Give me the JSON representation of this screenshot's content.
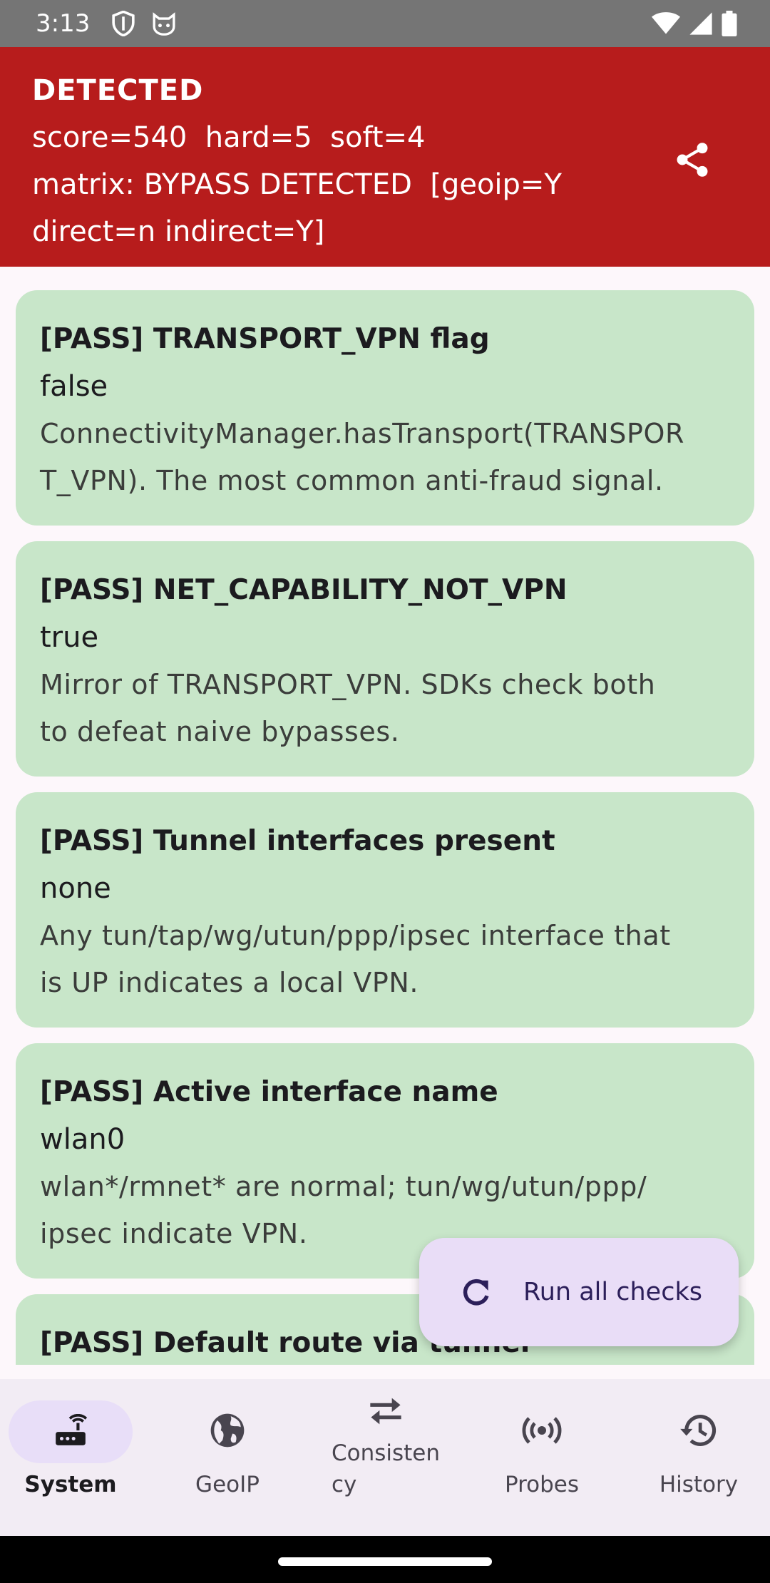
{
  "status_bar": {
    "time": "3:13",
    "icons": [
      "shield-icon",
      "cat-face-icon",
      "wifi-icon",
      "signal-icon",
      "battery-icon"
    ]
  },
  "banner": {
    "title": "DETECTED",
    "score_line": "score=540  hard=5  soft=4",
    "matrix_line1": "matrix: BYPASS DETECTED  [geoip=Y",
    "matrix_line2": "direct=n indirect=Y]",
    "color": "#b71c1c",
    "share_icon": "share-icon"
  },
  "cards": [
    {
      "title": "[PASS] TRANSPORT_VPN flag",
      "value": "false",
      "desc_line1": "ConnectivityManager.hasTransport(TRANSPOR",
      "desc_line2": "T_VPN). The most common anti-fraud signal."
    },
    {
      "title": "[PASS] NET_CAPABILITY_NOT_VPN",
      "value": "true",
      "desc_line1": "Mirror of TRANSPORT_VPN. SDKs check both",
      "desc_line2": "to defeat naive bypasses."
    },
    {
      "title": "[PASS] Tunnel interfaces present",
      "value": "none",
      "desc_line1": "Any tun/tap/wg/utun/ppp/ipsec interface that",
      "desc_line2": "is UP indicates a local VPN."
    },
    {
      "title": "[PASS] Active interface name",
      "value": "wlan0",
      "desc_line1": "wlan*/rmnet* are normal; tun/wg/utun/ppp/",
      "desc_line2": "ipsec indicate VPN."
    },
    {
      "title": "[PASS] Default route via tunnel"
    }
  ],
  "card_color": "#c8e6c9",
  "fab": {
    "label": "Run all checks",
    "icon": "refresh-icon"
  },
  "bottom_nav": {
    "items": [
      {
        "label": "System",
        "icon": "router-icon",
        "active": true
      },
      {
        "label": "GeoIP",
        "icon": "globe-icon",
        "active": false
      },
      {
        "label_line1": "Consisten",
        "label_line2": "cy",
        "icon": "swap-arrows-icon",
        "active": false
      },
      {
        "label": "Probes",
        "icon": "broadcast-icon",
        "active": false
      },
      {
        "label": "History",
        "icon": "history-icon",
        "active": false
      }
    ]
  }
}
